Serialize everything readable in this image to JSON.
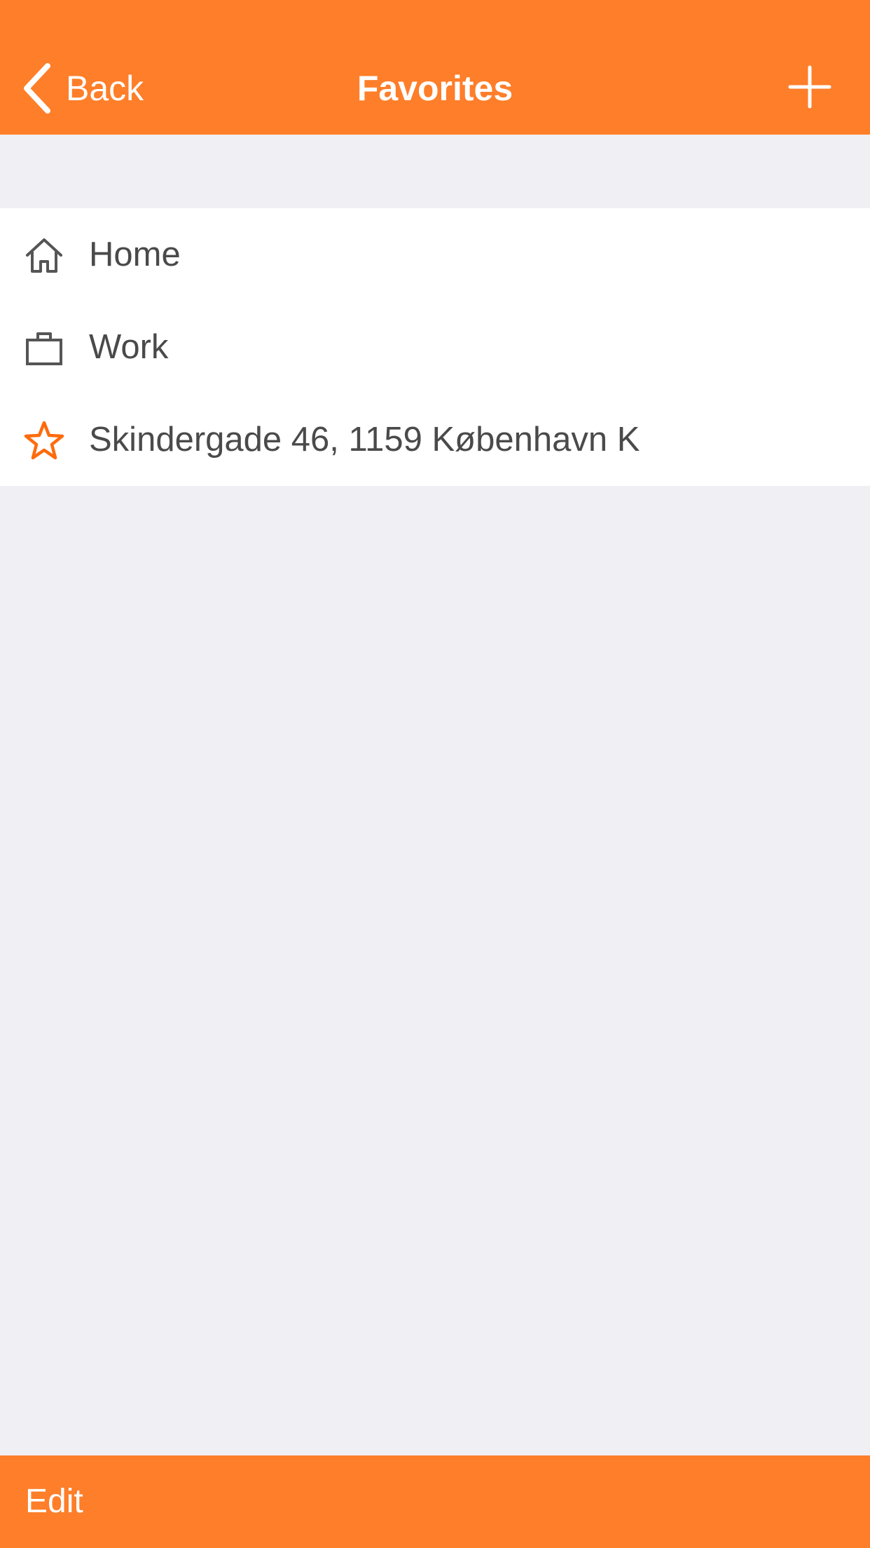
{
  "nav": {
    "back_label": "Back",
    "title": "Favorites",
    "add_icon": "plus-icon",
    "background": "#FE7E29"
  },
  "favorites": [
    {
      "label": "Home",
      "icon": "home-icon"
    },
    {
      "label": "Work",
      "icon": "briefcase-icon"
    },
    {
      "label": "Skindergade 46, 1159 København K",
      "icon": "star-icon",
      "icon_color": "#FE6B0C"
    }
  ],
  "toolbar": {
    "edit_label": "Edit"
  },
  "colors": {
    "accent": "#FE7E29",
    "background": "#EFEFF4",
    "text": "#4A4A4A"
  }
}
